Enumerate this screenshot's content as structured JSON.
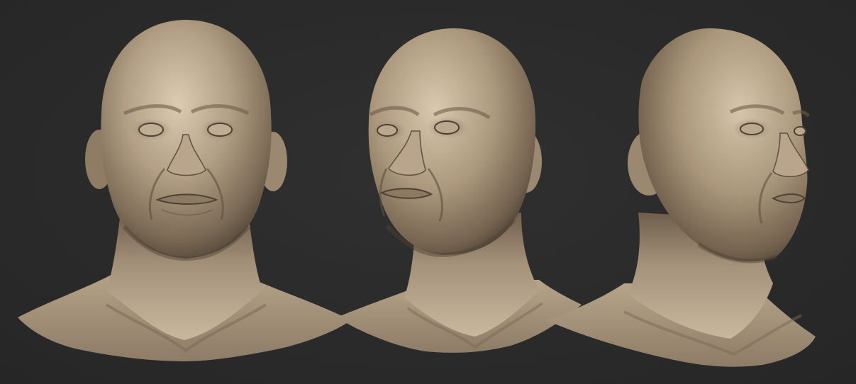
{
  "scene": {
    "background_color": "#2b2b2b",
    "material_color": "#a8977e",
    "material_highlight": "#d9c9b0",
    "material_shadow": "#5a4c3c",
    "subjects": [
      {
        "name": "head-bust-front-view",
        "view": "front"
      },
      {
        "name": "head-bust-three-quarter-left-view",
        "view": "three-quarter"
      },
      {
        "name": "head-bust-three-quarter-right-view",
        "view": "three-quarter"
      }
    ]
  }
}
